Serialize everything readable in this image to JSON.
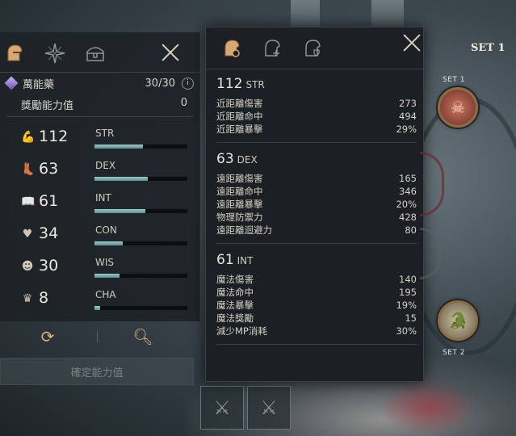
{
  "left_panel": {
    "tabs": [
      {
        "icon": "helmet-icon"
      },
      {
        "icon": "star-compass-icon"
      },
      {
        "icon": "treasure-chest-icon"
      }
    ],
    "potion": {
      "label": "萬能藥",
      "count": "30/30",
      "info": "i"
    },
    "bonus": {
      "label": "獎勵能力值",
      "value": "0"
    },
    "stats": [
      {
        "icon": "strength-arm-icon",
        "value": "112",
        "abbr": "STR",
        "fill": 0.52
      },
      {
        "icon": "dexterity-boot-icon",
        "value": "63",
        "abbr": "DEX",
        "fill": 0.57
      },
      {
        "icon": "intelligence-book-icon",
        "value": "61",
        "abbr": "INT",
        "fill": 0.55
      },
      {
        "icon": "constitution-heart-icon",
        "value": "34",
        "abbr": "CON",
        "fill": 0.3
      },
      {
        "icon": "wisdom-head-icon",
        "value": "30",
        "abbr": "WIS",
        "fill": 0.27
      },
      {
        "icon": "charisma-crown-icon",
        "value": "8",
        "abbr": "CHA",
        "fill": 0.06
      }
    ],
    "confirm_button": "確定能力值"
  },
  "detail_panel": {
    "sections": [
      {
        "value": "112",
        "abbr": "STR",
        "lines": [
          {
            "label": "近距離傷害",
            "value": "273"
          },
          {
            "label": "近距離命中",
            "value": "494"
          },
          {
            "label": "近距離暴擊",
            "value": "29%"
          }
        ]
      },
      {
        "value": "63",
        "abbr": "DEX",
        "lines": [
          {
            "label": "遠距離傷害",
            "value": "165"
          },
          {
            "label": "遠距離命中",
            "value": "346"
          },
          {
            "label": "遠距離暴擊",
            "value": "20%"
          },
          {
            "label": "物理防禦力",
            "value": "428"
          },
          {
            "label": "遠距離迴避力",
            "value": "80"
          }
        ]
      },
      {
        "value": "61",
        "abbr": "INT",
        "lines": [
          {
            "label": "魔法傷害",
            "value": "140"
          },
          {
            "label": "魔法命中",
            "value": "195"
          },
          {
            "label": "魔法暴擊",
            "value": "19%"
          },
          {
            "label": "魔法獎勵",
            "value": "15"
          },
          {
            "label": "減少MP消耗",
            "value": "30%"
          }
        ]
      }
    ]
  },
  "set_panel": {
    "title": "SET 1",
    "set1_label": "SET 1",
    "set2_label": "SET 2"
  }
}
